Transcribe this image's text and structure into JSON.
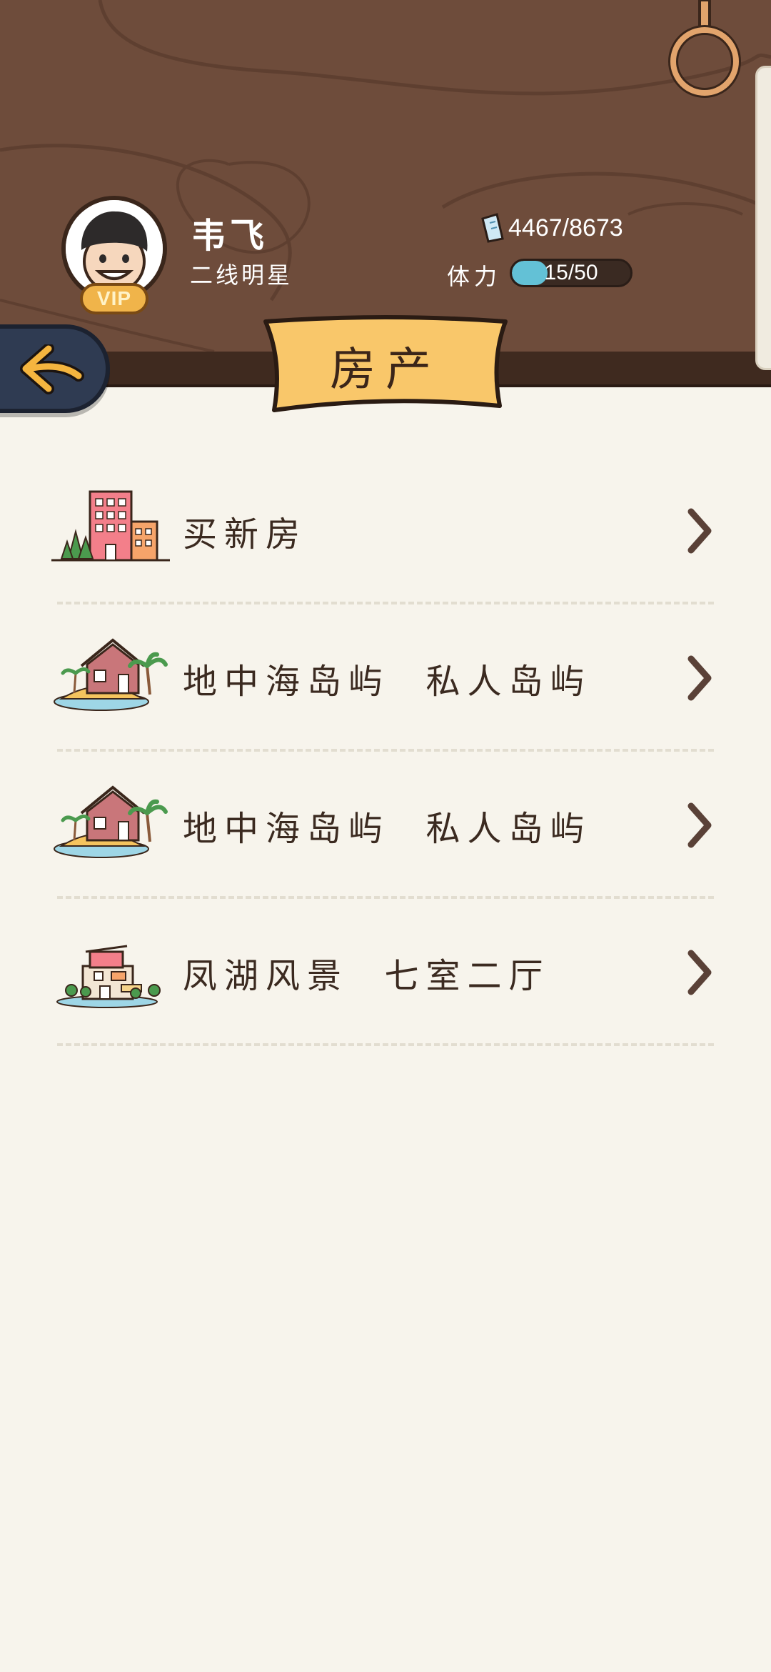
{
  "header": {
    "user_name": "韦飞",
    "user_title": "二线明星",
    "vip_badge": "VIP",
    "money": "4467/8673",
    "stamina_label": "体力",
    "stamina_text": "15/50",
    "stamina_fraction": 0.3
  },
  "page": {
    "title": "房产"
  },
  "list": {
    "items": [
      {
        "label": "买新房",
        "icon": "building-icon"
      },
      {
        "label": "地中海岛屿  私人岛屿",
        "icon": "island-house-icon"
      },
      {
        "label": "地中海岛屿  私人岛屿",
        "icon": "island-house-icon"
      },
      {
        "label": "凤湖风景  七室二厅",
        "icon": "villa-icon"
      }
    ]
  },
  "colors": {
    "wood": "#6e4c3b",
    "banner": "#f9c76a",
    "back_button": "#2f3b52",
    "arrow": "#f5b53f",
    "stamina_fill": "#63c1d6",
    "background": "#f7f4ec"
  }
}
